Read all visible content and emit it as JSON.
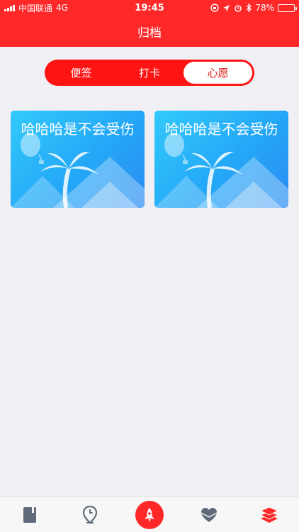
{
  "status_bar": {
    "carrier": "中国联通",
    "network": "4G",
    "time": "19:45",
    "battery": "78%",
    "battery_level": 0.78
  },
  "header": {
    "title": "归档"
  },
  "segments": [
    {
      "label": "便签",
      "active": false
    },
    {
      "label": "打卡",
      "active": false
    },
    {
      "label": "心愿",
      "active": true
    }
  ],
  "cards": [
    {
      "title": "哈哈哈是不会受伤"
    },
    {
      "title": "哈哈哈是不会受伤"
    }
  ],
  "tab_bar": {
    "icons": [
      "notebook-icon",
      "location-clock-icon",
      "rocket-icon",
      "heart-icon",
      "layers-icon"
    ],
    "accent": "#ff2828",
    "inactive": "#5f6b7a"
  },
  "colors": {
    "brand": "#ff2828",
    "background": "#f0eff4"
  }
}
